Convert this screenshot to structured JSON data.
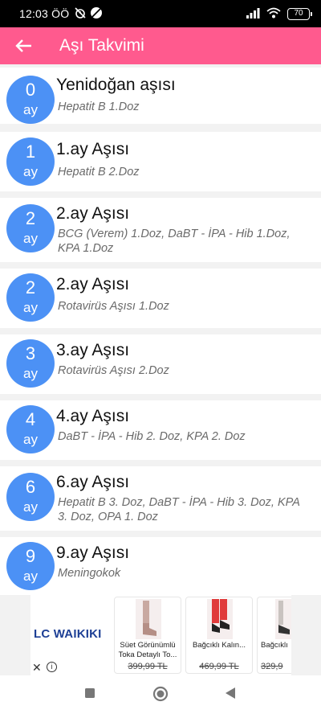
{
  "status_bar": {
    "time": "12:03 ÖÖ",
    "battery": "70",
    "icons": [
      "muted-alarm-icon",
      "blocked-icon",
      "signal-icon",
      "wifi-icon",
      "battery-icon"
    ]
  },
  "app_bar": {
    "title": "Aşı Takvimi",
    "icon": "back-arrow-icon",
    "color": "#ff5a8e"
  },
  "badge_color": "#4c91f5",
  "vaccines": [
    {
      "month": "0",
      "unit": "ay",
      "title": "Yenidoğan aşısı",
      "detail": "Hepatit B 1.Doz"
    },
    {
      "month": "1",
      "unit": "ay",
      "title": "1.ay Aşısı",
      "detail": "Hepatit B 2.Doz"
    },
    {
      "month": "2",
      "unit": "ay",
      "title": "2.ay Aşısı",
      "detail": "BCG (Verem) 1.Doz, DaBT - İPA - Hib 1.Doz, KPA 1.Doz"
    },
    {
      "month": "2",
      "unit": "ay",
      "title": "2.ay Aşısı",
      "detail": "Rotavirüs Aşısı 1.Doz"
    },
    {
      "month": "3",
      "unit": "ay",
      "title": "3.ay Aşısı",
      "detail": "Rotavirüs Aşısı 2.Doz"
    },
    {
      "month": "4",
      "unit": "ay",
      "title": "4.ay Aşısı",
      "detail": "DaBT - İPA - Hib 2. Doz, KPA 2. Doz"
    },
    {
      "month": "6",
      "unit": "ay",
      "title": "6.ay Aşısı",
      "detail": "Hepatit B 3. Doz, DaBT - İPA - Hib 3. Doz, KPA 3. Doz, OPA 1. Doz"
    },
    {
      "month": "9",
      "unit": "ay",
      "title": "9.ay Aşısı",
      "detail": "Meningokok"
    }
  ],
  "ad": {
    "brand": "LC WAIKIKI",
    "close_label": "✕",
    "info_label": "i",
    "products": [
      {
        "name": "Süet Görünümlü Toka Detaylı To...",
        "price": "399,99 TL"
      },
      {
        "name": "Bağcıklı Kalın...",
        "price": "469,99 TL"
      },
      {
        "name": "Bağcıklı",
        "price": "329,9"
      }
    ]
  },
  "nav_bar": {
    "icons": [
      "recent-apps-icon",
      "home-icon",
      "back-icon"
    ]
  }
}
